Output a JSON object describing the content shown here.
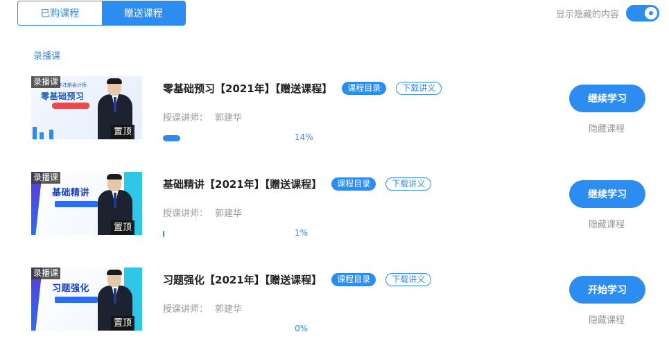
{
  "tabs": [
    {
      "label": "已购课程",
      "active": false
    },
    {
      "label": "赠送课程",
      "active": true
    }
  ],
  "toggle": {
    "label": "显示隐藏的内容",
    "on": true
  },
  "section": {
    "title": "录播课"
  },
  "courses": [
    {
      "thumb_tag": "录播课",
      "pin_tag": "置顶",
      "thumb_title": "零基础预习",
      "thumb_sub": "2021年注册会计师",
      "title": "零基础预习【2021年】【赠送课程】",
      "catalog_label": "课程目录",
      "download_label": "下载讲义",
      "lecturer_label": "授课讲师：",
      "lecturer_name": "郭建华",
      "progress": 0.14,
      "progress_text": "14%",
      "action_label": "继续学习",
      "hide_label": "隐藏课程"
    },
    {
      "thumb_tag": "录播课",
      "pin_tag": "置顶",
      "thumb_title": "基础精讲",
      "thumb_sub": "",
      "title": "基础精讲【2021年】【赠送课程】",
      "catalog_label": "课程目录",
      "download_label": "下载讲义",
      "lecturer_label": "授课讲师：",
      "lecturer_name": "郭建华",
      "progress": 0.01,
      "progress_text": "1%",
      "action_label": "继续学习",
      "hide_label": "隐藏课程"
    },
    {
      "thumb_tag": "录播课",
      "pin_tag": "置顶",
      "thumb_title": "习题强化",
      "thumb_sub": "",
      "title": "习题强化【2021年】【赠送课程】",
      "catalog_label": "课程目录",
      "download_label": "下载讲义",
      "lecturer_label": "授课讲师：",
      "lecturer_name": "郭建华",
      "progress": 0.0,
      "progress_text": "0%",
      "action_label": "开始学习",
      "hide_label": "隐藏课程"
    }
  ],
  "colors": {
    "accent": "#2d8cf0",
    "muted": "#999999"
  }
}
